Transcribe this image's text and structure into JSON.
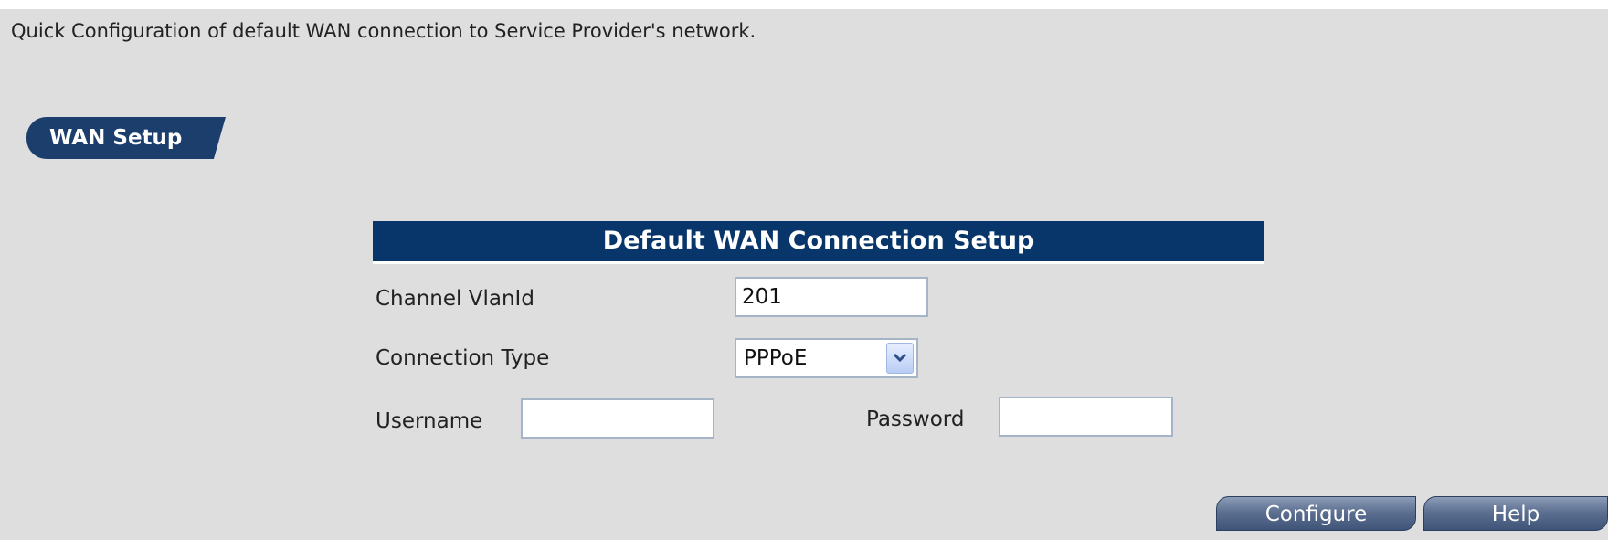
{
  "intro_text": "Quick Configuration of default WAN connection to Service Provider's network.",
  "section_tab": "WAN Setup",
  "table": {
    "title": "Default WAN Connection Setup"
  },
  "fields": {
    "channel_vlanid": {
      "label": "Channel VlanId",
      "value": "201"
    },
    "connection_type": {
      "label": "Connection Type",
      "selected": "PPPoE"
    },
    "username": {
      "label": "Username",
      "value": ""
    },
    "password": {
      "label": "Password",
      "value": ""
    }
  },
  "buttons": {
    "configure": "Configure",
    "help": "Help"
  },
  "colors": {
    "header_bg": "#08366a",
    "tab_bg": "#1b3e6c",
    "page_bg": "#dedede"
  }
}
